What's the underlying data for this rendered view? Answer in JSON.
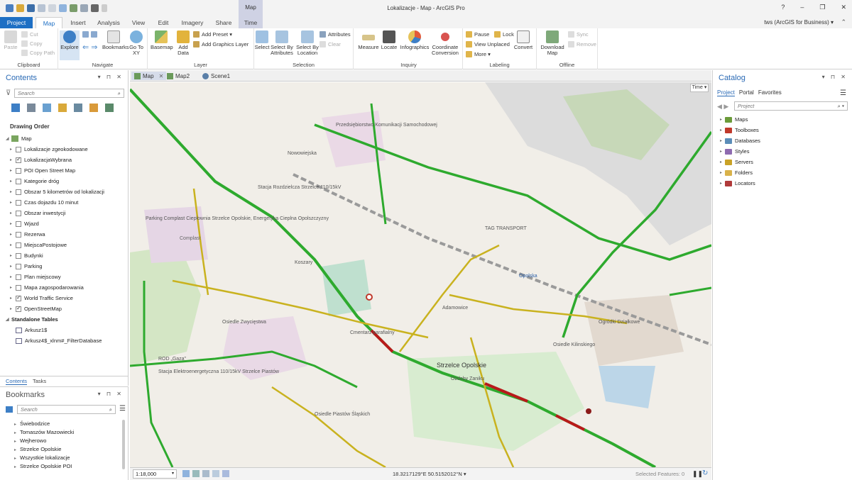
{
  "window": {
    "title": "Lokalizacje - Map - ArcGIS Pro",
    "context_tab_group": "Map",
    "controls": [
      "?",
      "–",
      "❐",
      "✕"
    ],
    "user": "tws (ArcGIS for Business) ▾"
  },
  "ribbon_tabs": [
    "Project",
    "Map",
    "Insert",
    "Analysis",
    "View",
    "Edit",
    "Imagery",
    "Share",
    "Time"
  ],
  "ribbon": {
    "clipboard": {
      "label": "Clipboard",
      "paste": "Paste",
      "cut": "Cut",
      "copy": "Copy",
      "copy_path": "Copy Path"
    },
    "navigate": {
      "label": "Navigate",
      "explore": "Explore",
      "bookmarks": "Bookmarks",
      "goto": "Go To XY"
    },
    "layer": {
      "label": "Layer",
      "basemap": "Basemap",
      "add_data": "Add Data",
      "add_preset": "Add Preset ▾",
      "add_graphics": "Add Graphics Layer"
    },
    "selection": {
      "label": "Selection",
      "select": "Select",
      "by_attr": "Select By Attributes",
      "by_loc": "Select By Location",
      "attributes": "Attributes",
      "clear": "Clear"
    },
    "inquiry": {
      "label": "Inquiry",
      "measure": "Measure",
      "locate": "Locate",
      "infographics": "Infographics",
      "coord": "Coordinate Conversion"
    },
    "labeling": {
      "label": "Labeling",
      "pause": "Pause",
      "lock": "Lock",
      "view_unplaced": "View Unplaced",
      "more": "More ▾",
      "convert": "Convert"
    },
    "offline": {
      "label": "Offline",
      "download": "Download Map",
      "sync": "Sync",
      "remove": "Remove"
    }
  },
  "contents": {
    "title": "Contents",
    "search_placeholder": "Search",
    "drawing_order": "Drawing Order",
    "map_name": "Map",
    "layers": [
      {
        "name": "Lokalizacje zgeokodowane",
        "checked": false
      },
      {
        "name": "LokalizacjaWybrana",
        "checked": true
      },
      {
        "name": "POI Open Street Map",
        "checked": false
      },
      {
        "name": "Kategorie dróg",
        "checked": false
      },
      {
        "name": "Obszar 5 kilometrów od lokalizacji",
        "checked": false
      },
      {
        "name": "Czas dojazdu 10 minut",
        "checked": false
      },
      {
        "name": "Obszar inwestycji",
        "checked": false
      },
      {
        "name": "Wjazd",
        "checked": false
      },
      {
        "name": "Rezerwa",
        "checked": false
      },
      {
        "name": "MiejscaPostojowe",
        "checked": false
      },
      {
        "name": "Budynki",
        "checked": false
      },
      {
        "name": "Parking",
        "checked": false
      },
      {
        "name": "Plan miejscowy",
        "checked": false
      },
      {
        "name": "Mapa zagospodarowania",
        "checked": false
      },
      {
        "name": "World Traffic Service",
        "checked": true
      },
      {
        "name": "OpenStreetMap",
        "checked": true
      }
    ],
    "standalone_tables_label": "Standalone Tables",
    "tables": [
      "Arkusz1$",
      "Arkusz4$_xlnm#_FilterDatabase"
    ],
    "bottom_tabs": [
      "Contents",
      "Tasks"
    ]
  },
  "bookmarks": {
    "title": "Bookmarks",
    "search_placeholder": "Search",
    "items": [
      "Świebodzice",
      "Tomaszów Mazowiecki",
      "Wejherowo",
      "Strzelce Opolskie",
      "Wszystkie lokalizacje",
      "Strzelce Opolskie POI"
    ]
  },
  "map_view": {
    "tabs": [
      "Map",
      "Map2",
      "Scene1"
    ],
    "time_label": "Time",
    "labels": {
      "station": "Stacja Rozdzielcza Strzelce 110/15kV",
      "przed": "Przedsiębiorstwo Komunikacji Samochodowej",
      "nowowiejska": "Nowowiejska",
      "parking": "Parking Complast Ciepłownia Strzelce Opolskie, Energetyka Cieplna Opolszczyzny",
      "complast": "Complast",
      "tag": "TAG TRANSPORT",
      "opolska": "Opolska",
      "ogrodki": "Ogródki Działkowe",
      "osiedle_zw": "Osiedle Zwycięstwa",
      "osiedle_p": "Osiedle Piastów Śląskich",
      "rod": "ROD „Gaza”",
      "adamowice": "Adamowice",
      "strzelce": "Strzelce Opolskie",
      "cmentarz": "Cmentarz parafialny",
      "koszary": "Koszary",
      "stacja_e": "Stacja Elektroenergetyczna 110/15kV Strzelce Piastów",
      "opolskie_park": "Osiedle Kilinskiego",
      "ozd": "Ozdoby Zaniku"
    },
    "scale": "1:18,000",
    "coordinates": "18.3217129°E 50.5152012°N",
    "selected_features": "Selected Features: 0"
  },
  "catalog": {
    "title": "Catalog",
    "tabs": [
      "Project",
      "Portal",
      "Favorites"
    ],
    "search_placeholder": "Project",
    "items": [
      {
        "name": "Maps",
        "color": "#6b9b3a"
      },
      {
        "name": "Toolboxes",
        "color": "#c0392b"
      },
      {
        "name": "Databases",
        "color": "#5b8db8"
      },
      {
        "name": "Styles",
        "color": "#8e6bb0"
      },
      {
        "name": "Servers",
        "color": "#c9a227"
      },
      {
        "name": "Folders",
        "color": "#d9b24a"
      },
      {
        "name": "Locators",
        "color": "#b03a3a"
      }
    ]
  },
  "colors": {
    "accent": "#1d6fc4",
    "traffic_free": "#2eaa2e",
    "traffic_moderate": "#c9b21f",
    "traffic_heavy": "#b81a1a"
  }
}
